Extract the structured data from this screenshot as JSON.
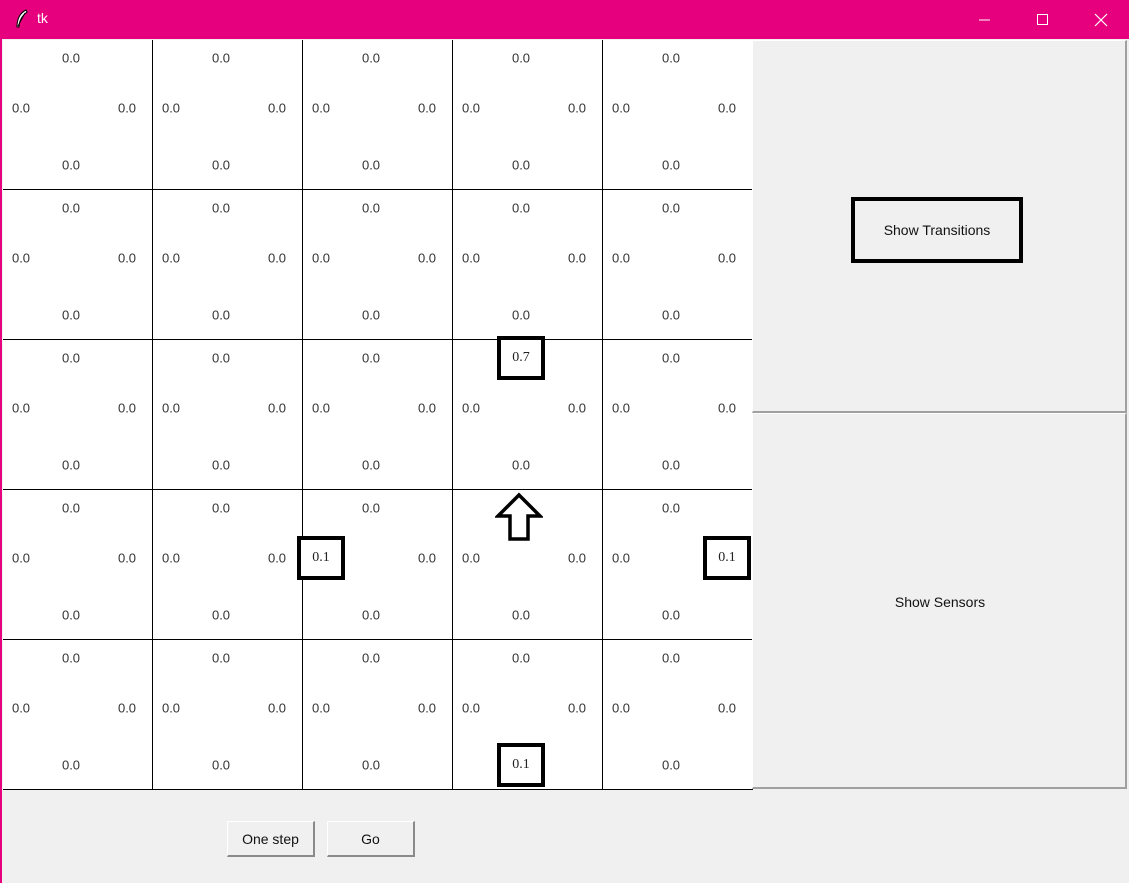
{
  "window": {
    "title": "tk",
    "title_bar_color": "#e6007e",
    "controls": [
      "minimize-icon",
      "maximize-icon",
      "close-icon"
    ]
  },
  "grid": {
    "rows": [
      [
        {
          "n": "0.0",
          "w": "0.0",
          "e": "0.0",
          "s": "0.0"
        },
        {
          "n": "0.0",
          "w": "0.0",
          "e": "0.0",
          "s": "0.0"
        },
        {
          "n": "0.0",
          "w": "0.0",
          "e": "0.0",
          "s": "0.0"
        },
        {
          "n": "0.0",
          "w": "0.0",
          "e": "0.0",
          "s": "0.0"
        },
        {
          "n": "0.0",
          "w": "0.0",
          "e": "0.0",
          "s": "0.0"
        }
      ],
      [
        {
          "n": "0.0",
          "w": "0.0",
          "e": "0.0",
          "s": "0.0"
        },
        {
          "n": "0.0",
          "w": "0.0",
          "e": "0.0",
          "s": "0.0"
        },
        {
          "n": "0.0",
          "w": "0.0",
          "e": "0.0",
          "s": "0.0"
        },
        {
          "n": "0.0",
          "w": "0.0",
          "e": "0.0",
          "s": "0.0"
        },
        {
          "n": "0.0",
          "w": "0.0",
          "e": "0.0",
          "s": "0.0"
        }
      ],
      [
        {
          "n": "0.0",
          "w": "0.0",
          "e": "0.0",
          "s": "0.0"
        },
        {
          "n": "0.0",
          "w": "0.0",
          "e": "0.0",
          "s": "0.0"
        },
        {
          "n": "0.0",
          "w": "0.0",
          "e": "0.0",
          "s": "0.0"
        },
        {
          "n": "0.7",
          "w": "0.0",
          "e": "0.0",
          "s": "0.0",
          "hl": [
            "n"
          ]
        },
        {
          "n": "0.0",
          "w": "0.0",
          "e": "0.0",
          "s": "0.0"
        }
      ],
      [
        {
          "n": "0.0",
          "w": "0.0",
          "e": "0.0",
          "s": "0.0"
        },
        {
          "n": "0.0",
          "w": "0.0",
          "e": "0.0",
          "s": "0.0"
        },
        {
          "n": "0.0",
          "w": "0.1",
          "e": "0.0",
          "s": "0.0",
          "hl": [
            "w"
          ]
        },
        {
          "n": "0.0",
          "w": "0.0",
          "e": "0.0",
          "s": "0.0",
          "robot": "up-arrow-icon"
        },
        {
          "n": "0.0",
          "w": "0.0",
          "e": "0.1",
          "s": "0.0",
          "hl": [
            "e"
          ]
        }
      ],
      [
        {
          "n": "0.0",
          "w": "0.0",
          "e": "0.0",
          "s": "0.0"
        },
        {
          "n": "0.0",
          "w": "0.0",
          "e": "0.0",
          "s": "0.0"
        },
        {
          "n": "0.0",
          "w": "0.0",
          "e": "0.0",
          "s": "0.0"
        },
        {
          "n": "0.0",
          "w": "0.0",
          "e": "0.0",
          "s": "0.1",
          "hl": [
            "s"
          ]
        },
        {
          "n": "0.0",
          "w": "0.0",
          "e": "0.0",
          "s": "0.0"
        }
      ]
    ]
  },
  "side_panel": {
    "show_transitions_label": "Show Transitions",
    "show_sensors_label": "Show Sensors"
  },
  "controls": {
    "one_step_label": "One step",
    "go_label": "Go"
  }
}
